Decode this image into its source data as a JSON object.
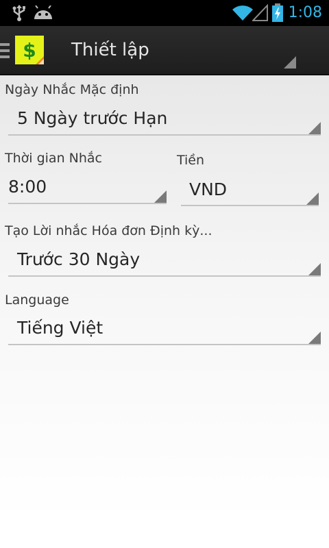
{
  "status_bar": {
    "time": "1:08",
    "time_color": "#33b5e5",
    "icons": [
      "usb-icon",
      "android-icon",
      "wifi-icon",
      "signal-icon",
      "battery-charging-icon"
    ]
  },
  "action_bar": {
    "title": "Thiết lập",
    "icons": [
      "menu-icon",
      "app-logo-dollar-icon",
      "overflow-triangle-icon"
    ]
  },
  "settings": {
    "default_reminder": {
      "label": "Ngày Nhắc Mặc định",
      "value": "5 Ngày trước Hạn"
    },
    "reminder_time": {
      "label": "Thời gian Nhắc",
      "value": "8:00"
    },
    "currency": {
      "label": "Tiền",
      "value": "VND"
    },
    "recurring_bill_reminder": {
      "label": "Tạo Lời nhắc Hóa đơn Định kỳ...",
      "value": "Trước 30 Ngày"
    },
    "language": {
      "label": "Language",
      "value": "Tiếng Việt"
    }
  },
  "colors": {
    "action_bar": "#222222",
    "accent": "#33b5e5",
    "logo_background": "#e4f21a",
    "logo_symbol": "#1b8a1b"
  }
}
